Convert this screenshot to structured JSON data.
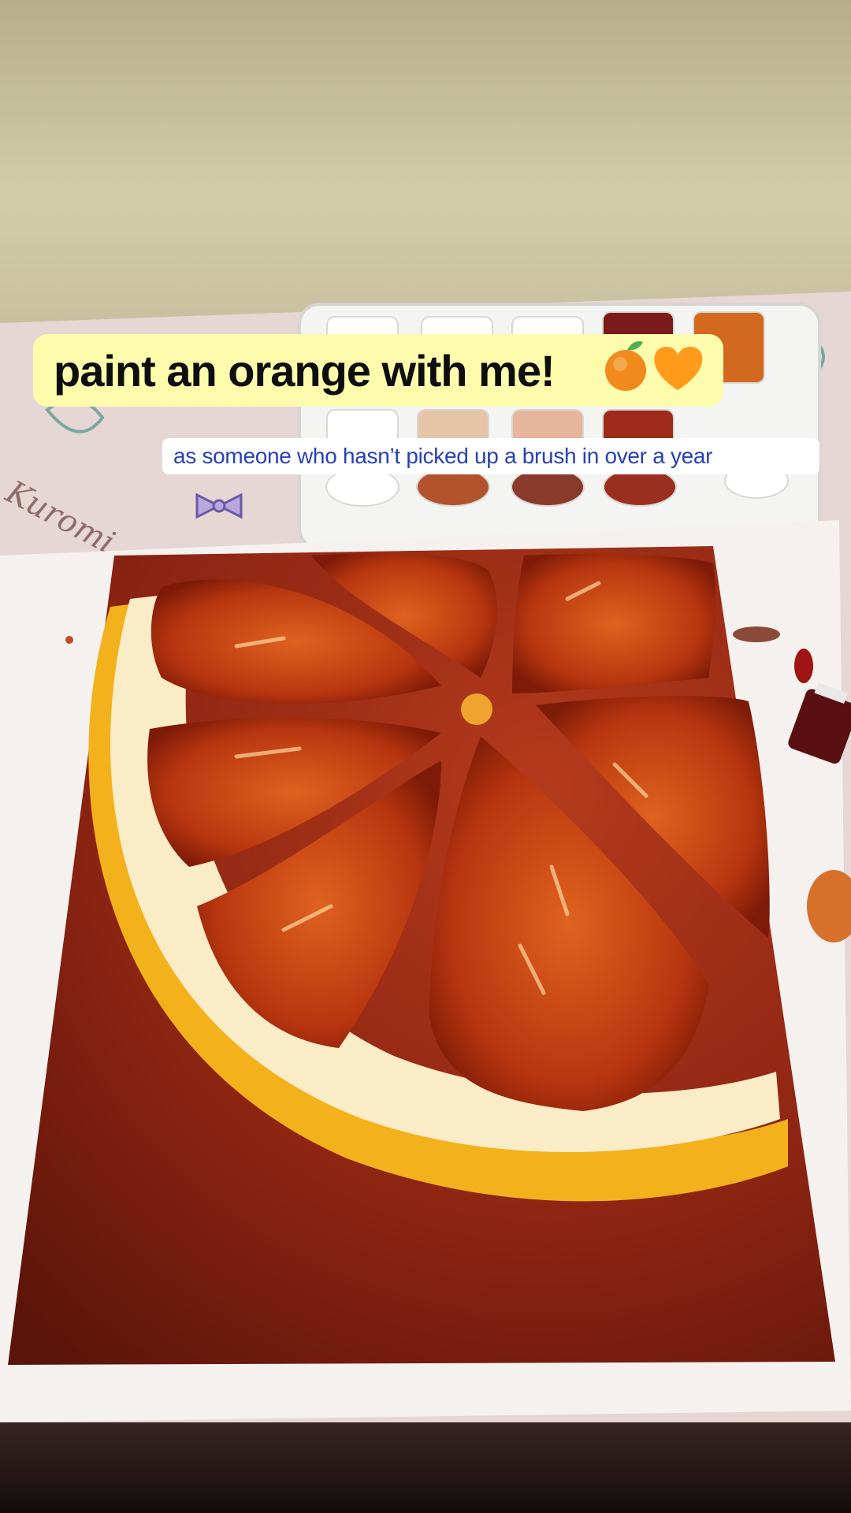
{
  "captions": {
    "title": "paint an orange with me!",
    "subtitle": "as someone who hasn’t picked up a brush in over a year"
  },
  "emojis": [
    "orange-emoji",
    "orange-heart-emoji"
  ],
  "scene": {
    "description_icons": [
      "wall",
      "paint-palette",
      "paper-towel",
      "canvas-orange-slice",
      "paint-tube"
    ],
    "colors": {
      "wall": "#cfc7a6",
      "table": "#e9dbd6",
      "canvas_dark": "#7a1f10",
      "pulp": "#c2410f",
      "pith": "#fbecc8",
      "rind": "#f3b11c",
      "caption_bg": "#fcfcac",
      "subtitle_text": "#2741b3"
    }
  }
}
